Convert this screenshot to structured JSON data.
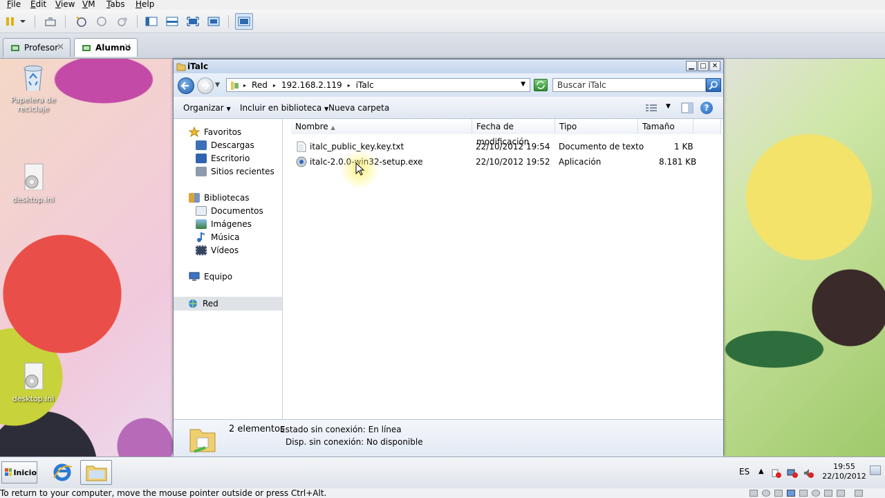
{
  "vm_menu": [
    {
      "key": "F",
      "rest": "ile"
    },
    {
      "key": "E",
      "rest": "dit"
    },
    {
      "key": "V",
      "rest": "iew"
    },
    {
      "key": "V",
      "rest": "M"
    },
    {
      "key": "T",
      "rest": "abs"
    },
    {
      "key": "H",
      "rest": "elp"
    }
  ],
  "vm_tabs": [
    {
      "label": "Profesor"
    },
    {
      "label": "Alumno"
    }
  ],
  "desktop_icons": [
    {
      "label": "Papelera de reciclaje"
    },
    {
      "label": "desktop.ini"
    },
    {
      "label": "desktop.ini"
    }
  ],
  "window": {
    "title": "iTalc",
    "address_parts": [
      "Red",
      "192.168.2.119",
      "iTalc"
    ],
    "search_placeholder": "Buscar iTalc"
  },
  "commands": {
    "organize": "Organizar",
    "include": "Incluir en biblioteca",
    "new_folder": "Nueva carpeta"
  },
  "nav": {
    "favorites": "Favoritos",
    "downloads": "Descargas",
    "desktop": "Escritorio",
    "recent": "Sitios recientes",
    "libraries": "Bibliotecas",
    "documents": "Documentos",
    "images": "Imágenes",
    "music": "Música",
    "videos": "Vídeos",
    "computer": "Equipo",
    "network": "Red"
  },
  "columns": {
    "name": "Nombre",
    "modified": "Fecha de modificación",
    "type": "Tipo",
    "size": "Tamaño"
  },
  "files": [
    {
      "name": "italc_public_key.key.txt",
      "modified": "22/10/2012 19:54",
      "type": "Documento de texto",
      "size": "1 KB"
    },
    {
      "name": "italc-2.0.0-win32-setup.exe",
      "modified": "22/10/2012 19:52",
      "type": "Aplicación",
      "size": "8.181 KB"
    }
  ],
  "details": {
    "count": "2 elementos",
    "offline_status": "Estado sin conexión: En línea",
    "offline_avail": "Disp. sin conexión: No disponible"
  },
  "taskbar": {
    "start": "Inicio",
    "lang": "ES",
    "time": "19:55",
    "date": "22/10/2012"
  },
  "hint": "To return to your computer, move the mouse pointer outside or press Ctrl+Alt."
}
